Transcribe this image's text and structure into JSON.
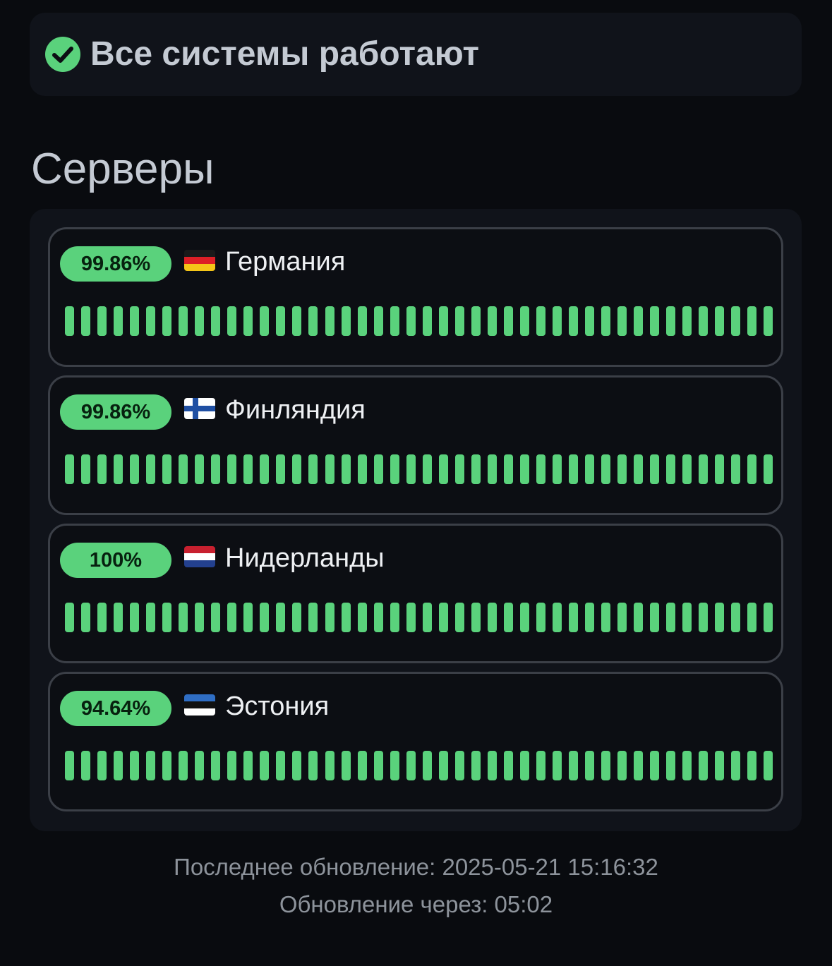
{
  "status": {
    "text": "Все системы работают",
    "icon": "check-circle-icon",
    "color": "#5ad27c"
  },
  "section_title": "Серверы",
  "servers": [
    {
      "uptime": "99.86%",
      "flag": "germany-flag-icon",
      "flag_colors": [
        "#1a1a1a",
        "#dd1f26",
        "#f5c518"
      ],
      "name": "Германия",
      "day_statuses": [
        "up",
        "up",
        "up",
        "up",
        "up",
        "up",
        "up",
        "up",
        "up",
        "up",
        "up",
        "up",
        "up",
        "up",
        "up",
        "up",
        "up",
        "up",
        "up",
        "up",
        "up",
        "up",
        "up",
        "up",
        "up",
        "up",
        "up",
        "up",
        "up",
        "up",
        "up",
        "up",
        "up",
        "up",
        "up",
        "up",
        "up",
        "up",
        "up",
        "up",
        "up",
        "up",
        "up",
        "up"
      ]
    },
    {
      "uptime": "99.86%",
      "flag": "finland-flag-icon",
      "flag_colors": [
        "#ffffff",
        "#1f4fa3"
      ],
      "name": "Финляндия",
      "day_statuses": [
        "up",
        "up",
        "up",
        "up",
        "up",
        "up",
        "up",
        "up",
        "up",
        "up",
        "up",
        "up",
        "up",
        "up",
        "up",
        "up",
        "up",
        "up",
        "up",
        "up",
        "up",
        "up",
        "up",
        "up",
        "up",
        "up",
        "up",
        "up",
        "up",
        "up",
        "up",
        "up",
        "up",
        "up",
        "up",
        "up",
        "up",
        "up",
        "up",
        "up",
        "up",
        "up",
        "up",
        "up"
      ]
    },
    {
      "uptime": "100%",
      "flag": "netherlands-flag-icon",
      "flag_colors": [
        "#c8202f",
        "#ffffff",
        "#23408e"
      ],
      "name": "Нидерланды",
      "day_statuses": [
        "up",
        "up",
        "up",
        "up",
        "up",
        "up",
        "up",
        "up",
        "up",
        "up",
        "up",
        "up",
        "up",
        "up",
        "up",
        "up",
        "up",
        "up",
        "up",
        "up",
        "up",
        "up",
        "up",
        "up",
        "up",
        "up",
        "up",
        "up",
        "up",
        "up",
        "up",
        "up",
        "up",
        "up",
        "up",
        "up",
        "up",
        "up",
        "up",
        "up",
        "up",
        "up",
        "up",
        "up"
      ]
    },
    {
      "uptime": "94.64%",
      "flag": "estonia-flag-icon",
      "flag_colors": [
        "#2f6ec5",
        "#111111",
        "#ffffff"
      ],
      "name": "Эстония",
      "day_statuses": [
        "up",
        "up",
        "up",
        "up",
        "up",
        "up",
        "up",
        "up",
        "up",
        "up",
        "up",
        "up",
        "up",
        "up",
        "up",
        "up",
        "up",
        "up",
        "up",
        "up",
        "up",
        "up",
        "up",
        "up",
        "up",
        "up",
        "up",
        "up",
        "up",
        "up",
        "up",
        "up",
        "up",
        "up",
        "up",
        "up",
        "up",
        "up",
        "up",
        "up",
        "up",
        "up",
        "up",
        "up"
      ]
    }
  ],
  "footer": {
    "last_update": "Последнее обновление: 2025-05-21 15:16:32",
    "next_update": "Обновление через: 05:02"
  }
}
